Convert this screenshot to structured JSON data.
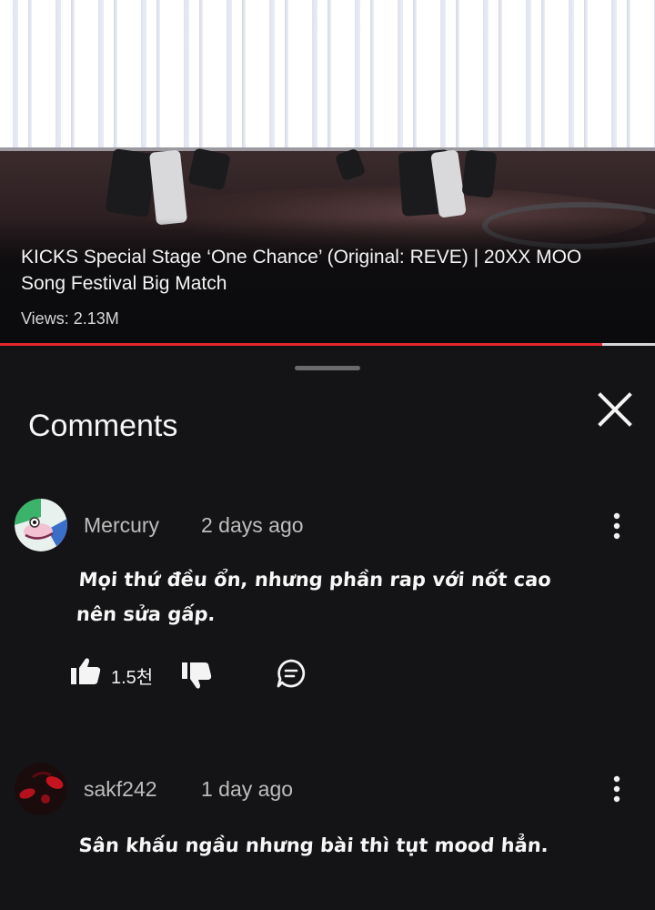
{
  "video": {
    "title": "KICKS Special Stage ‘One Chance’ (Original: REVE) | 20XX MOO Song Festival Big Match",
    "views": "Views: 2.13M",
    "progress": 0.92
  },
  "sheet": {
    "title": "Comments",
    "close_icon": "close-icon"
  },
  "comments": [
    {
      "author": "Mercury",
      "time": "2 days ago",
      "text": "Mọi thứ đều ổn, nhưng phần rap với nốt cao nên sửa gấp.",
      "likes": "1.5천"
    },
    {
      "author": "sakf242",
      "time": "1 day ago",
      "text": "Sân khấu ngầu nhưng bài thì tụt mood hẳn."
    }
  ],
  "colors": {
    "accent": "#e6252d",
    "background": "#141416",
    "meta_text": "#bdbdbd"
  }
}
